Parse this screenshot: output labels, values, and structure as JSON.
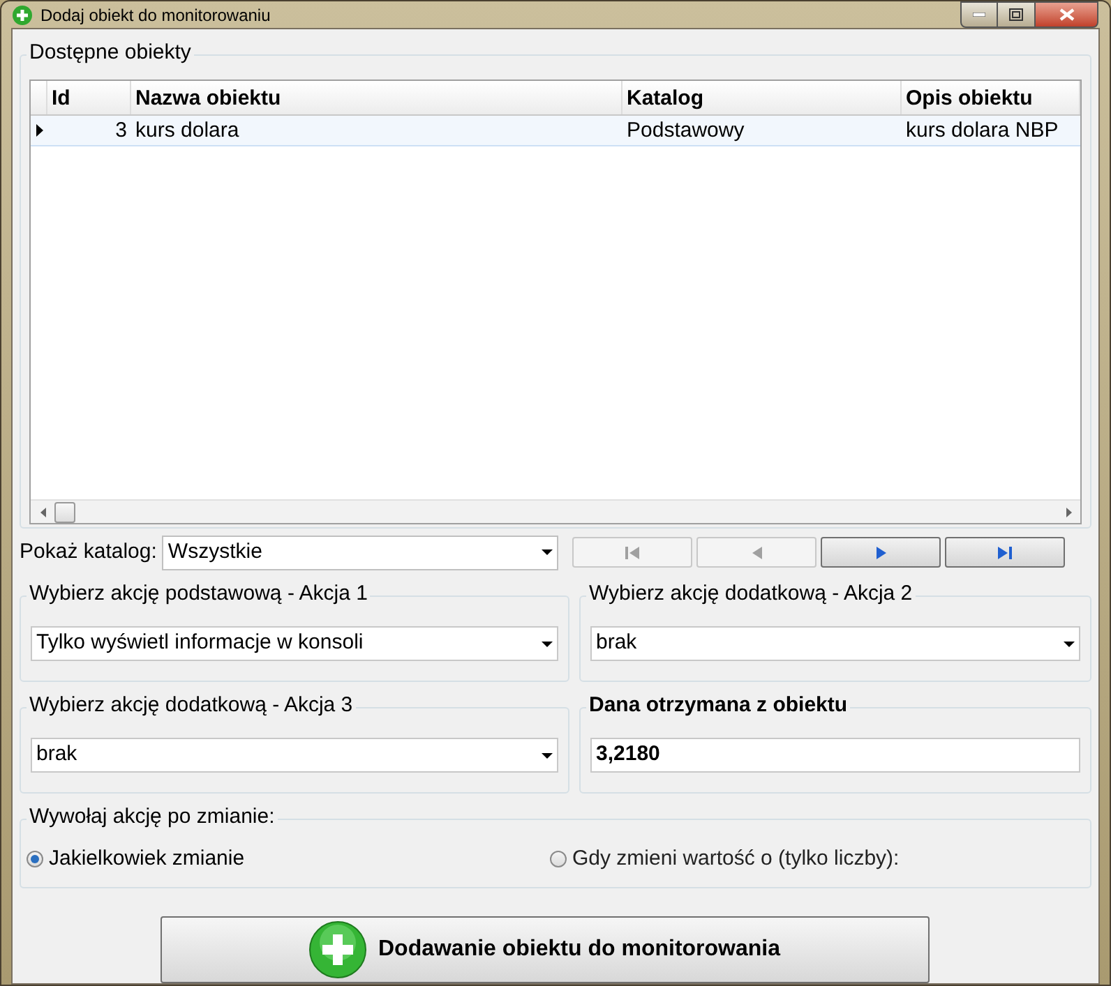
{
  "window": {
    "title": "Dodaj obiekt do monitorowaniu"
  },
  "objects_group": {
    "title": "Dostępne obiekty",
    "table": {
      "columns": [
        "Id",
        "Nazwa obiektu",
        "Katalog",
        "Opis obiektu"
      ],
      "rows": [
        {
          "selected": true,
          "cells": [
            "3",
            "kurs dolara",
            "Podstawowy",
            "kurs dolara NBP"
          ]
        }
      ]
    }
  },
  "catalog": {
    "label": "Pokaż katalog:",
    "value": "Wszystkie"
  },
  "nav_buttons": [
    {
      "kind": "first",
      "disabled": true
    },
    {
      "kind": "prev",
      "disabled": true
    },
    {
      "kind": "next",
      "disabled": false
    },
    {
      "kind": "last",
      "disabled": false
    }
  ],
  "action_groups": [
    {
      "kind": "select",
      "title": "Wybierz akcję podstawową - Akcja 1",
      "value": "Tylko wyświetl informacje w konsoli"
    },
    {
      "kind": "select",
      "title": "Wybierz akcję dodatkową - Akcja 2",
      "value": "brak"
    },
    {
      "kind": "select",
      "title": "Wybierz akcję dodatkową - Akcja 3",
      "value": "brak"
    },
    {
      "kind": "readout",
      "title": "Dana otrzymana z obiektu",
      "value": "3,2180"
    }
  ],
  "trigger_group": {
    "title": "Wywołaj akcję po zmianie:",
    "options": [
      {
        "label": "Jakielkowiek zmianie",
        "selected": true
      },
      {
        "label": "Gdy zmieni wartość o (tylko liczby):",
        "selected": false
      }
    ]
  },
  "add_button": {
    "label": "Dodawanie obiektu do monitorowania"
  }
}
